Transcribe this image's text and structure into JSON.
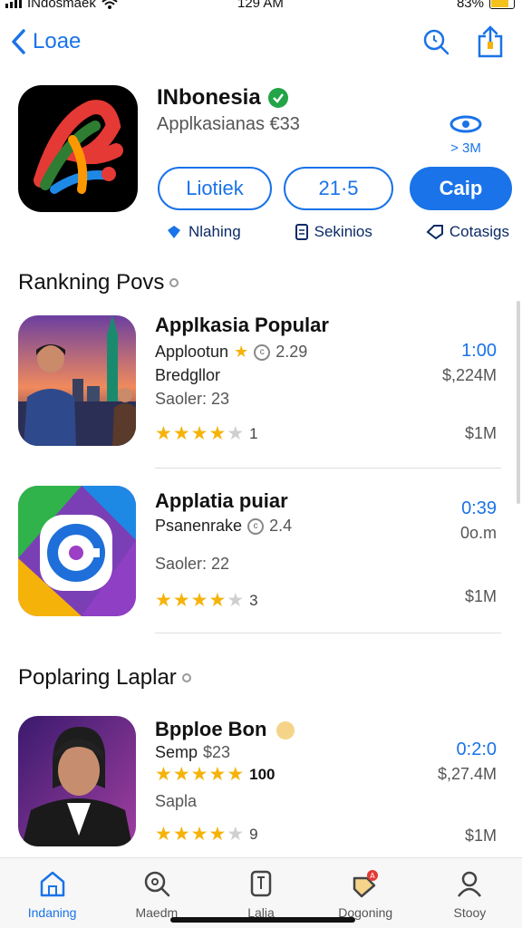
{
  "status": {
    "carrier": "INdosmaek",
    "time": "129 AM",
    "battery": "83%"
  },
  "nav": {
    "back_label": "Loae"
  },
  "app": {
    "name": "INbonesia",
    "subtitle": "Applkasianas €33",
    "side_value": "> 3M",
    "buttons": [
      "Liotiek",
      "21·5",
      "Caip"
    ],
    "meta": [
      "Nlahing",
      "Sekinios",
      "Cotasigs"
    ]
  },
  "section1": {
    "title": "Rankning Povs"
  },
  "section2": {
    "title": "Poplaring Laplar"
  },
  "items": [
    {
      "title": "Applkasia Popular",
      "line1": "Applootun",
      "line1_value": "2.29",
      "line2": "Bredgllor",
      "line3": "Saoler: 23",
      "stars": 4,
      "star_count": "1",
      "right_top": "1:00",
      "right_mid": "$,224M",
      "right_bottom": "$1M"
    },
    {
      "title": "Applatia puiar",
      "line1": "Psanenrake",
      "line1_value": "2.4",
      "line3": "Saoler: 22",
      "stars": 4,
      "star_count": "3",
      "right_top": "0:39",
      "right_mid": "0o.m",
      "right_bottom": "$1M"
    },
    {
      "title": "Bpploe Bon",
      "line1": "Semp",
      "line1_value": "$23",
      "rating_count": "100",
      "line3": "Sapla",
      "stars": 4,
      "star_count": "9",
      "right_top": "0:2:0",
      "right_mid": "$,27.4M",
      "right_bottom": "$1M"
    }
  ],
  "tabs": [
    "Indaning",
    "Maedm",
    "Lalia",
    "Dogoning",
    "Stooy"
  ],
  "colors": {
    "accent": "#1a73e8",
    "star": "#f5b30a",
    "verified": "#22a447"
  }
}
